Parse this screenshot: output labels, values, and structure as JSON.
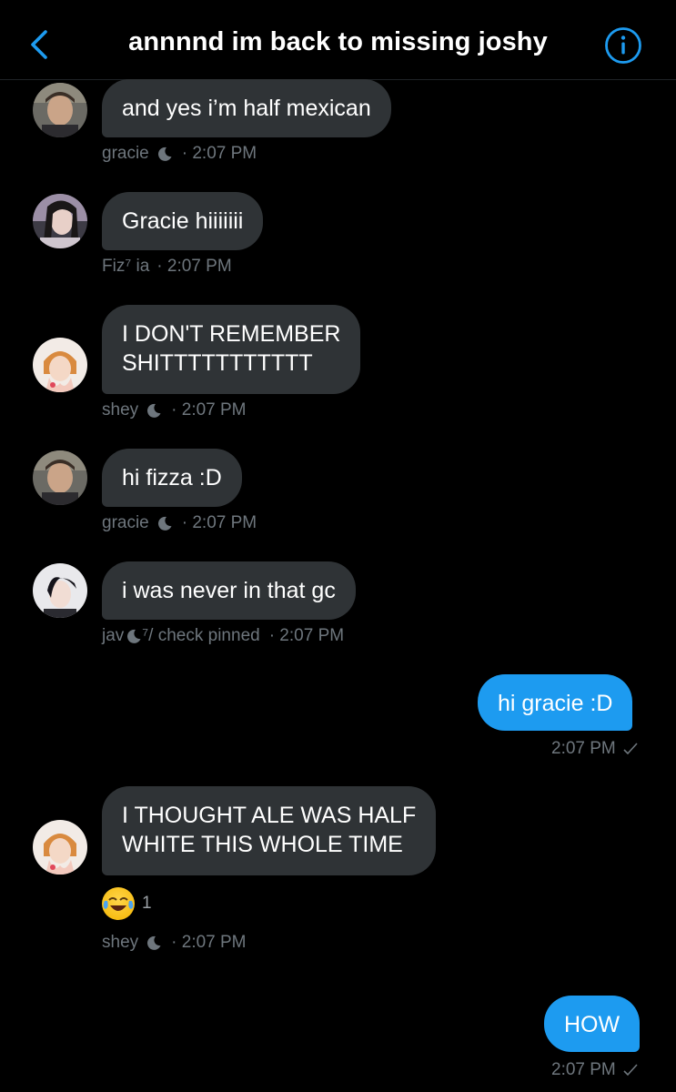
{
  "header": {
    "title": "annnnd im back to missing joshy",
    "back_icon": "chevron-left-icon",
    "info_icon": "info-icon",
    "accent": "#1d9bf0"
  },
  "colors": {
    "incoming": "#2f3336",
    "outgoing": "#1d9bf0",
    "meta": "#6e767d"
  },
  "messages": [
    {
      "text": "and yes i’m half mexican",
      "sender": "gracie",
      "time": "· 2:07 PM"
    },
    {
      "text": "Gracie hiiiiiii",
      "sender": "Fiz⁷ ia",
      "time": "· 2:07 PM"
    },
    {
      "line1": "I DON'T REMEMBER",
      "line2": "SHITTTTTTTTTTT",
      "sender": "shey",
      "time": "· 2:07 PM"
    },
    {
      "text": "hi fizza :D",
      "sender": "gracie",
      "time": "· 2:07 PM"
    },
    {
      "text": "i was never in that gc",
      "sender_a": "jav",
      "sender_b": "⁷/ check pinned",
      "time": "· 2:07 PM"
    },
    {
      "text": "hi gracie :D",
      "time": "2:07 PM"
    },
    {
      "line1": "I THOUGHT ALE WAS HALF",
      "line2": "WHITE THIS WHOLE TIME",
      "sender": "shey",
      "time": "· 2:07 PM",
      "reaction_count": "1",
      "reaction_icon": "tears-of-joy-emoji-icon"
    },
    {
      "text": "HOW",
      "time": "2:07 PM"
    }
  ]
}
